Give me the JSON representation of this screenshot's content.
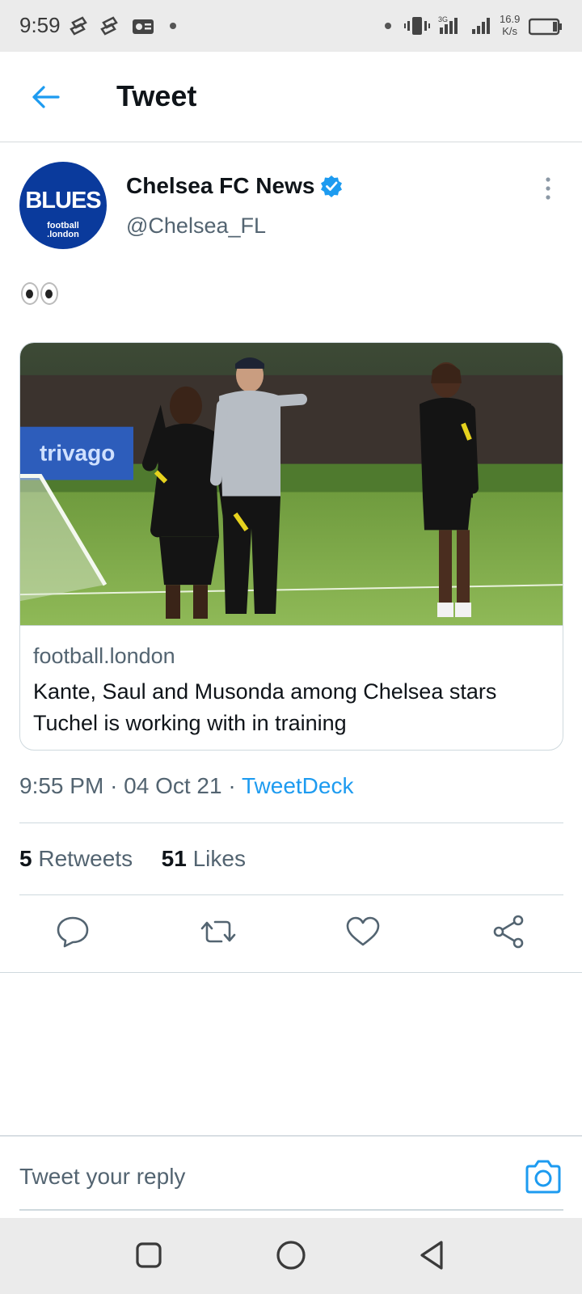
{
  "status_bar": {
    "time": "9:59",
    "net_speed_value": "16.9",
    "net_speed_unit": "K/s"
  },
  "header": {
    "title": "Tweet"
  },
  "tweet": {
    "avatar_text": "BLUES",
    "avatar_subtext_1": "football",
    "avatar_subtext_2": ".london",
    "author_name": "Chelsea FC News",
    "author_handle": "@Chelsea_FL",
    "text": "👀",
    "card": {
      "domain": "football.london",
      "title": "Kante, Saul and Musonda among Chelsea stars Tuchel is working with in training",
      "image_banner_text": "trivago"
    },
    "time": "9:55 PM",
    "date": "04 Oct 21",
    "source": "TweetDeck",
    "retweets_count": "5",
    "retweets_label": "Retweets",
    "likes_count": "51",
    "likes_label": "Likes"
  },
  "reply": {
    "placeholder": "Tweet your reply"
  },
  "colors": {
    "accent": "#1d9bf0",
    "text_primary": "#0f1419",
    "text_secondary": "#536471",
    "divider": "#cfd9de",
    "avatar_bg": "#0a3a9c"
  }
}
